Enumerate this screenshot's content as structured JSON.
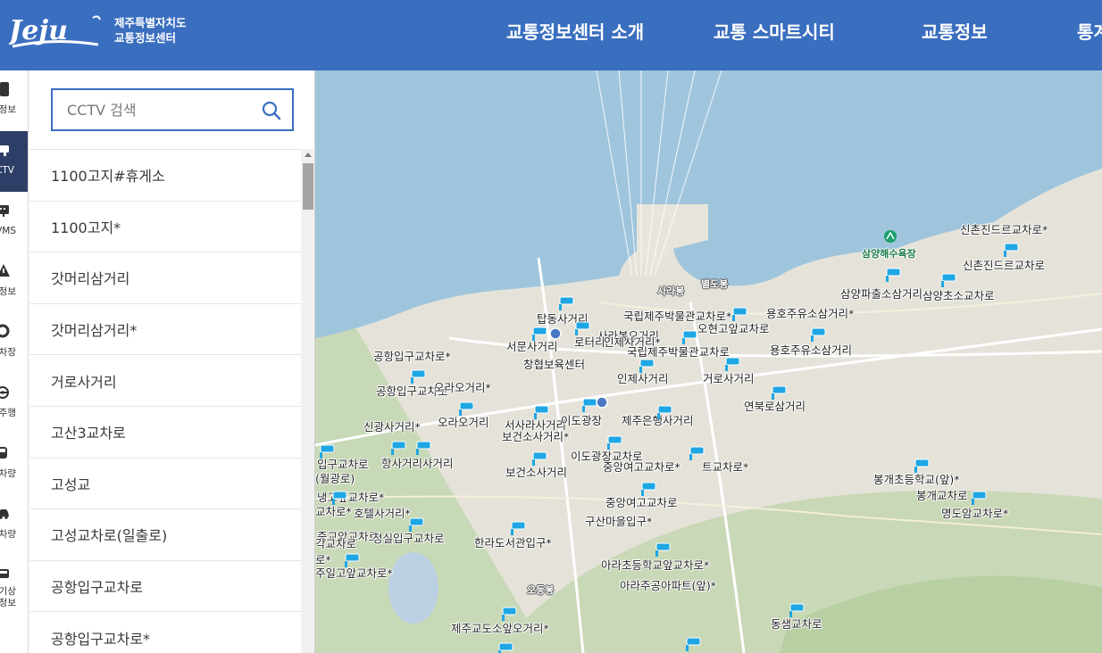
{
  "header": {
    "logo_text": "Jeju",
    "org_line1": "제주특별자치도",
    "org_line2": "교통정보센터",
    "nav": [
      "교통정보센터 소개",
      "교통 스마트시티",
      "교통정보",
      "통계"
    ]
  },
  "rail": {
    "items": [
      {
        "label": "정보",
        "icon": "traffic-light-icon",
        "active": false
      },
      {
        "label": "CCTV",
        "icon": "cctv-camera-icon",
        "active": true
      },
      {
        "label": "VMS",
        "icon": "vms-board-icon",
        "active": false
      },
      {
        "label": "돌발정보",
        "icon": "warning-icon",
        "active": false
      },
      {
        "label": "주차장",
        "icon": "parking-icon",
        "active": false
      },
      {
        "label": "자율주행",
        "icon": "steering-icon",
        "active": false
      },
      {
        "label": "차량",
        "icon": "bus-icon",
        "active": false
      },
      {
        "label": "BIS차량",
        "icon": "car-icon",
        "active": false
      },
      {
        "label": "기상\n정보",
        "icon": "weather-vehicle-icon",
        "active": false
      }
    ]
  },
  "cctv_panel": {
    "search_placeholder": "CCTV 검색",
    "items": [
      "1100고지#휴게소",
      "1100고지*",
      "갓머리삼거리",
      "갓머리삼거리*",
      "거로사거리",
      "고산3교차로",
      "고성교",
      "고성교차로(일출로)",
      "공항입구교차로",
      "공항입구교차로*"
    ]
  },
  "map": {
    "place_labels": [
      "사라봉",
      "별도봉",
      "삼양해수욕장",
      "오등봉"
    ],
    "camera_labels": [
      "신촌진드르교차로*",
      "신촌진드르교차로",
      "삼양파출소삼거리",
      "삼양초소교차로",
      "탑동사거리",
      "국립제주박물관교차로*",
      "용호주유소삼거리*",
      "사라봉오거리",
      "오현고앞교차로",
      "서문사거리",
      "로터리",
      "인제사거리*",
      "국립제주박물관교차로",
      "용호주유소삼거리",
      "공항입구교차로*",
      "창협보육센터",
      "인제사거리",
      "거로사거리",
      "공항입구교차로",
      "오라오거리*",
      "연북로삼거리",
      "신광사거리*",
      "오라오거리",
      "서사라사거리",
      "이도광장",
      "제주은행사거리",
      "보건소사거리*",
      "이도광장교차로",
      "중앙여고교차로*",
      "트교차로*",
      "입구교차로",
      "항사거리사거리",
      "(월광로)",
      "보건소사거리",
      "봉개초등학교(앞)*",
      "냉고앞교차로*",
      "봉개교차로",
      "명도암교차로*",
      "중앙여고교차로",
      "교차로*",
      "호텔사거리*",
      "구산마을입구*",
      "중교앞교차로",
      "정실입구교차로",
      "한라도서관입구*",
      "각교차로",
      "로*",
      "아라초등학교앞교차로*",
      "주일고앞교차로*",
      "아라주공아파트(앞)*",
      "동샘교차로",
      "제주교도소앞오거리*"
    ]
  }
}
